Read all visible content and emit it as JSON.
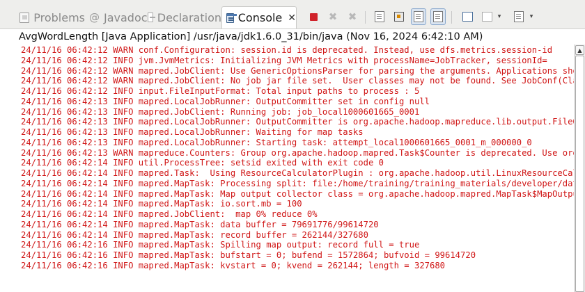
{
  "tabs": [
    {
      "label": "Problems",
      "icon": "problems-icon"
    },
    {
      "label": "Javadoc",
      "icon": "at-icon"
    },
    {
      "label": "Declaration",
      "icon": "declaration-icon"
    },
    {
      "label": "Console",
      "icon": "console-icon",
      "active": true
    }
  ],
  "tab_close_glyph": "✕",
  "toolbar": {
    "icons": [
      "terminate-icon",
      "remove-launch-icon",
      "remove-all-terminated-icon",
      "clear-console-icon",
      "scroll-lock-icon",
      "show-stdout-icon",
      "show-stderr-icon",
      "pin-console-icon",
      "display-console-icon",
      "open-console-icon"
    ],
    "dropdown_glyph": "▾"
  },
  "launch_path": "AvgWordLength [Java Application] /usr/java/jdk1.6.0_31/bin/java (Nov 16, 2024 6:42:10 AM)",
  "log_lines": [
    "24/11/16 06:42:12 WARN conf.Configuration: session.id is deprecated. Instead, use dfs.metrics.session-id",
    "24/11/16 06:42:12 INFO jvm.JvmMetrics: Initializing JVM Metrics with processName=JobTracker, sessionId=",
    "24/11/16 06:42:12 WARN mapred.JobClient: Use GenericOptionsParser for parsing the arguments. Applications should",
    "24/11/16 06:42:12 WARN mapred.JobClient: No job jar file set.  User classes may not be found. See JobConf(Class) o",
    "24/11/16 06:42:12 INFO input.FileInputFormat: Total input paths to process : 5",
    "24/11/16 06:42:13 INFO mapred.LocalJobRunner: OutputCommitter set in config null",
    "24/11/16 06:42:13 INFO mapred.JobClient: Running job: job_local1000601665_0001",
    "24/11/16 06:42:13 INFO mapred.LocalJobRunner: OutputCommitter is org.apache.hadoop.mapreduce.lib.output.FileOutpu",
    "24/11/16 06:42:13 INFO mapred.LocalJobRunner: Waiting for map tasks",
    "24/11/16 06:42:13 INFO mapred.LocalJobRunner: Starting task: attempt_local1000601665_0001_m_000000_0",
    "24/11/16 06:42:13 WARN mapreduce.Counters: Group org.apache.hadoop.mapred.Task$Counter is deprecated. Use org.apa",
    "24/11/16 06:42:14 INFO util.ProcessTree: setsid exited with exit code 0",
    "24/11/16 06:42:14 INFO mapred.Task:  Using ResourceCalculatorPlugin : org.apache.hadoop.util.LinuxResourceCalcula",
    "24/11/16 06:42:14 INFO mapred.MapTask: Processing split: file:/home/training/training_materials/developer/data/sh",
    "24/11/16 06:42:14 INFO mapred.MapTask: Map output collector class = org.apache.hadoop.mapred.MapTask$MapOutputBuf",
    "24/11/16 06:42:14 INFO mapred.MapTask: io.sort.mb = 100",
    "24/11/16 06:42:14 INFO mapred.JobClient:  map 0% reduce 0%",
    "24/11/16 06:42:14 INFO mapred.MapTask: data buffer = 79691776/99614720",
    "24/11/16 06:42:14 INFO mapred.MapTask: record buffer = 262144/327680",
    "24/11/16 06:42:16 INFO mapred.MapTask: Spilling map output: record full = true",
    "24/11/16 06:42:16 INFO mapred.MapTask: bufstart = 0; bufend = 1572864; bufvoid = 99614720",
    "24/11/16 06:42:16 INFO mapred.MapTask: kvstart = 0; kvend = 262144; length = 327680"
  ],
  "colors": {
    "log_text": "#d01616",
    "terminate": "#d0222a"
  }
}
